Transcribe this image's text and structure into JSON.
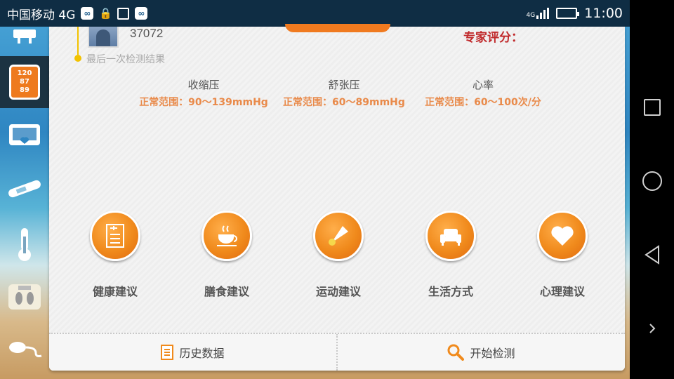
{
  "status_bar": {
    "carrier": "中国移动 4G",
    "network": "4G",
    "time": "11:00"
  },
  "sidebar": {
    "items": [
      {
        "name": "scale",
        "icon": "scale-icon"
      },
      {
        "name": "blood-pressure",
        "icon": "blood-pressure-monitor-icon",
        "readings": [
          "120",
          "87",
          "89"
        ],
        "active": true
      },
      {
        "name": "monitor",
        "icon": "heart-monitor-icon"
      },
      {
        "name": "thermometer-strip",
        "icon": "ear-thermometer-icon"
      },
      {
        "name": "thermometer",
        "icon": "thermometer-icon"
      },
      {
        "name": "body-fat",
        "icon": "foot-scale-icon"
      },
      {
        "name": "stethoscope",
        "icon": "stethoscope-icon"
      }
    ]
  },
  "header": {
    "user_id": "37072",
    "last_result": "最后一次检测结果",
    "expert_score": "专家评分："
  },
  "metrics": [
    {
      "title": "收缩压",
      "range": "正常范围：90～139mmHg"
    },
    {
      "title": "舒张压",
      "range": "正常范围：60～89mmHg"
    },
    {
      "title": "心率",
      "range": "正常范围：60～100次/分"
    }
  ],
  "tiles": [
    {
      "label": "健康建议",
      "icon": "health-record-icon"
    },
    {
      "label": "膳食建议",
      "icon": "coffee-cup-icon"
    },
    {
      "label": "运动建议",
      "icon": "shuttlecock-icon"
    },
    {
      "label": "生活方式",
      "icon": "sofa-icon"
    },
    {
      "label": "心理建议",
      "icon": "heart-icon"
    }
  ],
  "footer": {
    "history_label": "历史数据",
    "start_label": "开始检测"
  },
  "colors": {
    "accent": "#f08a1c",
    "expert": "#c0292b",
    "range_text": "#e98a4a",
    "status_bar": "#0f2d44"
  }
}
